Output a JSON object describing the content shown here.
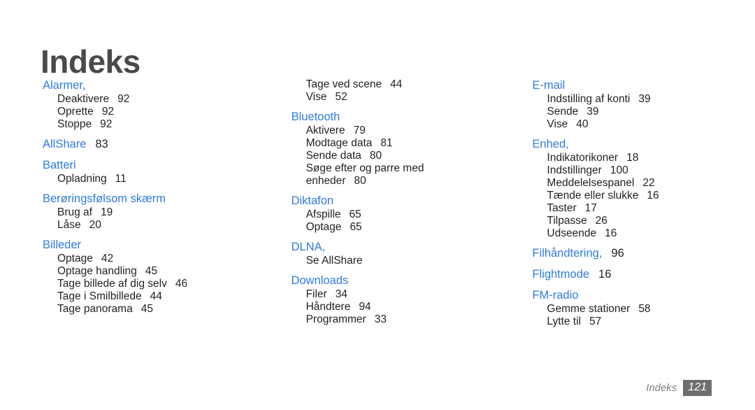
{
  "title": "Indeks",
  "colors": {
    "heading": "#2f7ce0",
    "body": "#231f20",
    "title": "#4a4a4a",
    "footer_badge_bg": "#6e6e6e",
    "footer_label": "#808080",
    "background": "#ffffff"
  },
  "footer": {
    "label": "Indeks",
    "page_number": "121"
  },
  "columns": [
    {
      "groups": [
        {
          "heading": "Alarmer,",
          "heading_page": "",
          "entries": [
            {
              "text": "Deaktivere",
              "page": "92"
            },
            {
              "text": "Oprette",
              "page": "92"
            },
            {
              "text": "Stoppe",
              "page": "92"
            }
          ]
        },
        {
          "heading": "AllShare",
          "heading_page": "83",
          "entries": []
        },
        {
          "heading": "Batteri",
          "heading_page": "",
          "entries": [
            {
              "text": "Opladning",
              "page": "11"
            }
          ]
        },
        {
          "heading": "Berøringsfølsom skærm",
          "heading_page": "",
          "entries": [
            {
              "text": "Brug af",
              "page": "19"
            },
            {
              "text": "Låse",
              "page": "20"
            }
          ]
        },
        {
          "heading": "Billeder",
          "heading_page": "",
          "entries": [
            {
              "text": "Optage",
              "page": "42"
            },
            {
              "text": "Optage handling",
              "page": "45"
            },
            {
              "text": "Tage billede af dig selv",
              "page": "46"
            },
            {
              "text": "Tage i Smilbillede",
              "page": "44"
            },
            {
              "text": "Tage panorama",
              "page": "45"
            }
          ]
        }
      ]
    },
    {
      "groups": [
        {
          "heading": "",
          "heading_page": "",
          "entries": [
            {
              "text": "Tage ved scene",
              "page": "44"
            },
            {
              "text": "Vise",
              "page": "52"
            }
          ]
        },
        {
          "heading": "Bluetooth",
          "heading_page": "",
          "entries": [
            {
              "text": "Aktivere",
              "page": "79"
            },
            {
              "text": "Modtage data",
              "page": "81"
            },
            {
              "text": "Sende data",
              "page": "80"
            },
            {
              "text": "Søge efter og parre med",
              "page": ""
            },
            {
              "text": "enheder",
              "page": "80"
            }
          ]
        },
        {
          "heading": "Diktafon",
          "heading_page": "",
          "entries": [
            {
              "text": "Afspille",
              "page": "65"
            },
            {
              "text": "Optage",
              "page": "65"
            }
          ]
        },
        {
          "heading": "DLNA,",
          "heading_page": "",
          "entries": [
            {
              "text": "Se AllShare",
              "page": ""
            }
          ]
        },
        {
          "heading": "Downloads",
          "heading_page": "",
          "entries": [
            {
              "text": "Filer",
              "page": "34"
            },
            {
              "text": "Håndtere",
              "page": "94"
            },
            {
              "text": "Programmer",
              "page": "33"
            }
          ]
        }
      ]
    },
    {
      "groups": [
        {
          "heading": "E-mail",
          "heading_page": "",
          "entries": [
            {
              "text": "Indstilling af konti",
              "page": "39"
            },
            {
              "text": "Sende",
              "page": "39"
            },
            {
              "text": "Vise",
              "page": "40"
            }
          ]
        },
        {
          "heading": "Enhed,",
          "heading_page": "",
          "entries": [
            {
              "text": "Indikatorikoner",
              "page": "18"
            },
            {
              "text": "Indstillinger",
              "page": "100"
            },
            {
              "text": "Meddelelsespanel",
              "page": "22"
            },
            {
              "text": "Tænde eller slukke",
              "page": "16"
            },
            {
              "text": "Taster",
              "page": "17"
            },
            {
              "text": "Tilpasse",
              "page": "26"
            },
            {
              "text": "Udseende",
              "page": "16"
            }
          ]
        },
        {
          "heading": "Filhåndtering,",
          "heading_page": "96",
          "entries": []
        },
        {
          "heading": "Flightmode",
          "heading_page": "16",
          "entries": []
        },
        {
          "heading": "FM-radio",
          "heading_page": "",
          "entries": [
            {
              "text": "Gemme stationer",
              "page": "58"
            },
            {
              "text": "Lytte til",
              "page": "57"
            }
          ]
        }
      ]
    }
  ]
}
